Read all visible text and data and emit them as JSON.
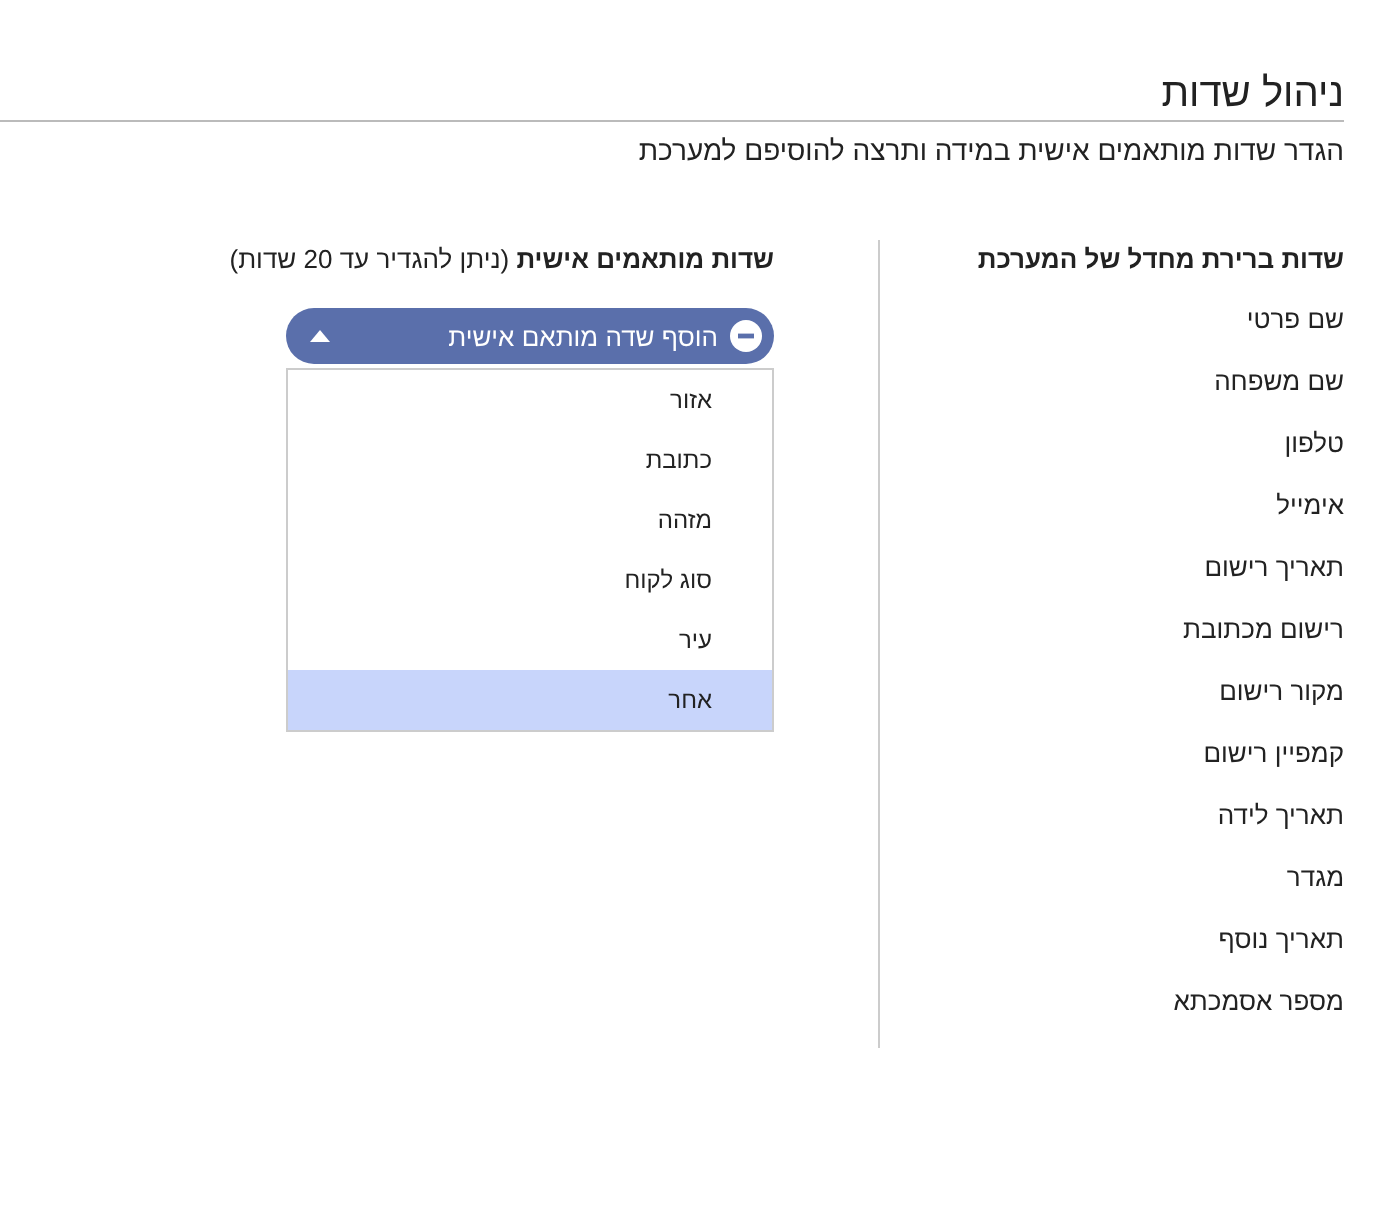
{
  "title": "ניהול שדות",
  "description": "הגדר שדות מותאמים אישית במידה ותרצה להוסיפם למערכת",
  "default_fields": {
    "heading": "שדות ברירת מחדל של המערכת",
    "items": [
      "שם פרטי",
      "שם משפחה",
      "טלפון",
      "אימייל",
      "תאריך רישום",
      "רישום מכתובת",
      "מקור רישום",
      "קמפיין רישום",
      "תאריך לידה",
      "מגדר",
      "תאריך נוסף",
      "מספר אסמכתא"
    ]
  },
  "custom_fields": {
    "heading": "**שדות מותאמים אישית** (ניתן להגדיר עד 20 שדות)",
    "add_button": {
      "label": "הוסף שדה מותאם אישית",
      "expanded": true
    },
    "options": [
      {
        "label": "אזור",
        "selected": false
      },
      {
        "label": "כתובת",
        "selected": false
      },
      {
        "label": "מזהה",
        "selected": false
      },
      {
        "label": "סוג לקוח",
        "selected": false
      },
      {
        "label": "עיר",
        "selected": false
      },
      {
        "label": "אחר",
        "selected": true
      }
    ]
  }
}
